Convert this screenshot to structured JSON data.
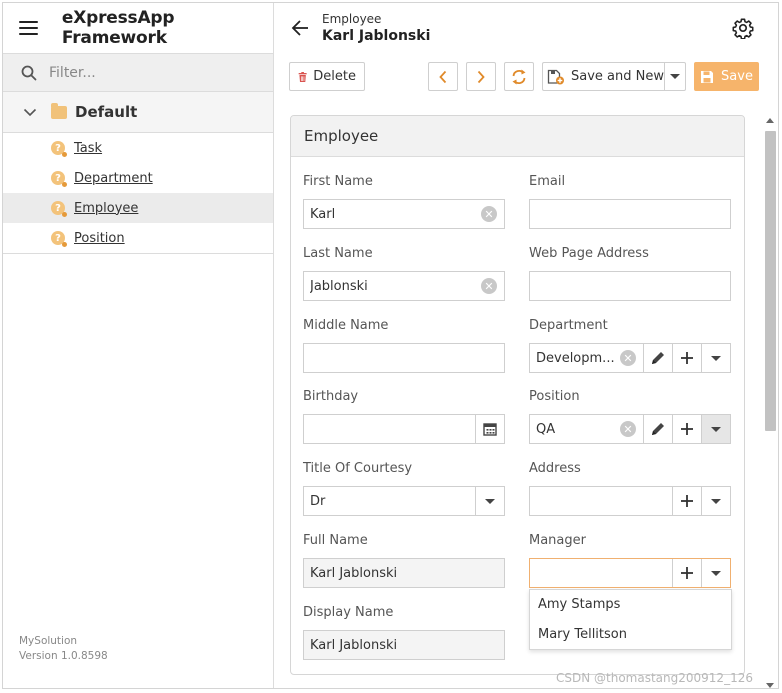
{
  "app": {
    "title": "eXpressApp Framework"
  },
  "navigation": {
    "filter_placeholder": "Filter...",
    "group": {
      "label": "Default"
    },
    "items": [
      {
        "label": "Task"
      },
      {
        "label": "Department"
      },
      {
        "label": "Employee"
      },
      {
        "label": "Position"
      }
    ],
    "active_item": "Employee"
  },
  "version": {
    "solution": "MySolution",
    "version_text": "Version 1.0.8598"
  },
  "view": {
    "subtitle": "Employee",
    "title": "Karl Jablonski"
  },
  "toolbar": {
    "delete_label": "Delete",
    "save_and_new_label": "Save and New",
    "save_label": "Save"
  },
  "card": {
    "title": "Employee"
  },
  "fields": {
    "first_name": {
      "label": "First Name",
      "value": "Karl"
    },
    "last_name": {
      "label": "Last Name",
      "value": "Jablonski"
    },
    "middle_name": {
      "label": "Middle Name",
      "value": ""
    },
    "birthday": {
      "label": "Birthday",
      "value": ""
    },
    "title_of_courtesy": {
      "label": "Title Of Courtesy",
      "value": "Dr"
    },
    "full_name": {
      "label": "Full Name",
      "value": "Karl Jablonski"
    },
    "display_name": {
      "label": "Display Name",
      "value": "Karl Jablonski"
    },
    "email": {
      "label": "Email",
      "value": ""
    },
    "web_page_address": {
      "label": "Web Page Address",
      "value": ""
    },
    "department": {
      "label": "Department",
      "value": "Developm..."
    },
    "position": {
      "label": "Position",
      "value": "QA"
    },
    "address": {
      "label": "Address",
      "value": ""
    },
    "manager": {
      "label": "Manager",
      "value": ""
    }
  },
  "manager_dropdown": {
    "options": [
      "Amy Stamps",
      "Mary Tellitson"
    ]
  },
  "watermark": {
    "text": "CSDN @thomastang200912_126"
  },
  "colors": {
    "accent": "#f6b46b",
    "icon_orange": "#f3c37b",
    "delete_red": "#d9534f"
  }
}
